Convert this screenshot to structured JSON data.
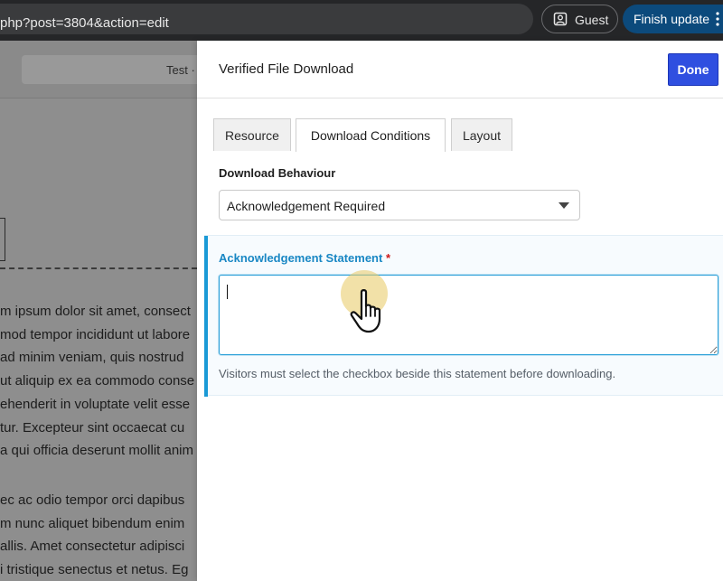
{
  "browser": {
    "url_fragment": "php?post=3804&action=edit",
    "guest_label": "Guest",
    "finish_update_label": "Finish update"
  },
  "editor": {
    "test_label": "Test ·",
    "paragraph1": [
      "m ipsum dolor sit amet, consect",
      "mod tempor incididunt ut labore",
      " ad minim veniam, quis nostrud",
      "ut aliquip ex ea commodo conse",
      "ehenderit in voluptate velit esse",
      "tur. Excepteur sint occaecat cu",
      "a qui officia deserunt mollit anim"
    ],
    "paragraph2": [
      "ec ac odio tempor orci dapibus",
      "m nunc aliquet bibendum enim",
      "allis. Amet consectetur adipisci",
      "i tristique senectus et netus. Eg"
    ]
  },
  "panel": {
    "title": "Verified File Download",
    "done_label": "Done",
    "tabs": [
      {
        "label": "Resource",
        "active": false
      },
      {
        "label": "Download Conditions",
        "active": true
      },
      {
        "label": "Layout",
        "active": false
      }
    ],
    "download_behaviour_label": "Download Behaviour",
    "download_behaviour_value": "Acknowledgement Required",
    "ack_label": "Acknowledgement Statement",
    "ack_required_mark": "*",
    "ack_value": "",
    "ack_help": "Visitors must select the checkbox beside this statement before downloading."
  },
  "colors": {
    "done_button": "#2f4fe0",
    "accent_blue": "#1a9ad6",
    "finish_update": "#0c4a7c"
  },
  "icons": [
    "user-account-icon",
    "kebab-menu-icon",
    "chevron-down-icon",
    "hand-pointer-icon"
  ]
}
